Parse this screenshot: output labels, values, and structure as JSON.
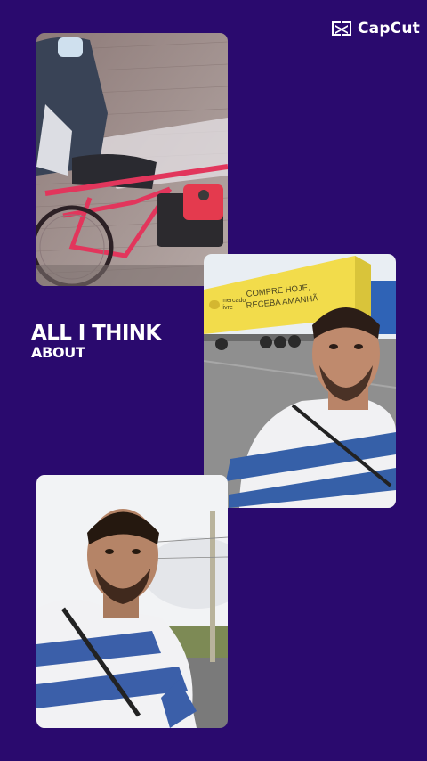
{
  "app": {
    "logo_text": "CapCut",
    "logo_icon": "capcut-logo-icon"
  },
  "headline": {
    "line1": "ALL I THINK",
    "line2": "ABOUT"
  },
  "photos": [
    {
      "subject": "red motorized bicycle",
      "icon": "photo-bike"
    },
    {
      "subject": "man selfie in front of truck",
      "icon": "photo-truck"
    },
    {
      "subject": "man selfie by road",
      "icon": "photo-road"
    }
  ],
  "truck_sign": {
    "brand_line1": "mercado",
    "brand_line2": "livre",
    "slogan_line1": "COMPRE HOJE,",
    "slogan_line2": "RECEBA AMANHÃ"
  },
  "colors": {
    "background": "#2a0a6e",
    "text": "#ffffff",
    "truck_yellow": "#f2dc4b"
  }
}
